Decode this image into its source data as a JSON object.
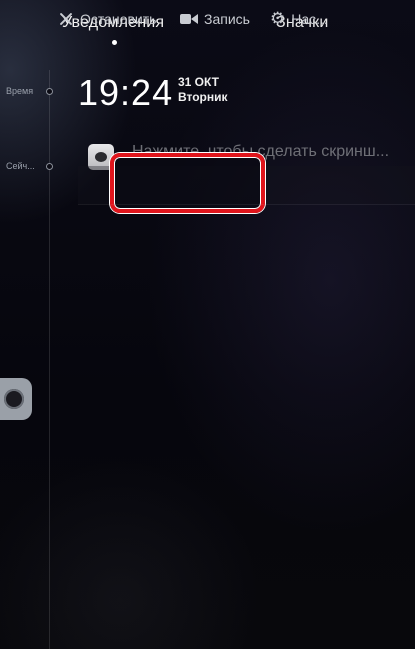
{
  "tabs": {
    "notifications": "Уведомления",
    "badges": "Значки"
  },
  "timeline": {
    "time_label": "Время",
    "now_label": "Сейч..."
  },
  "clock": {
    "time": "19:24",
    "date": "31 ОКТ",
    "weekday": "Вторник"
  },
  "notification": {
    "icon": "screen-recorder-icon",
    "title": "Нажмите, чтобы сделать скринш...",
    "actions": {
      "stop": "Остановить",
      "record": "Запись",
      "settings": "Нас..."
    }
  },
  "colors": {
    "highlight": "#e0151c",
    "background": "#07070f"
  }
}
